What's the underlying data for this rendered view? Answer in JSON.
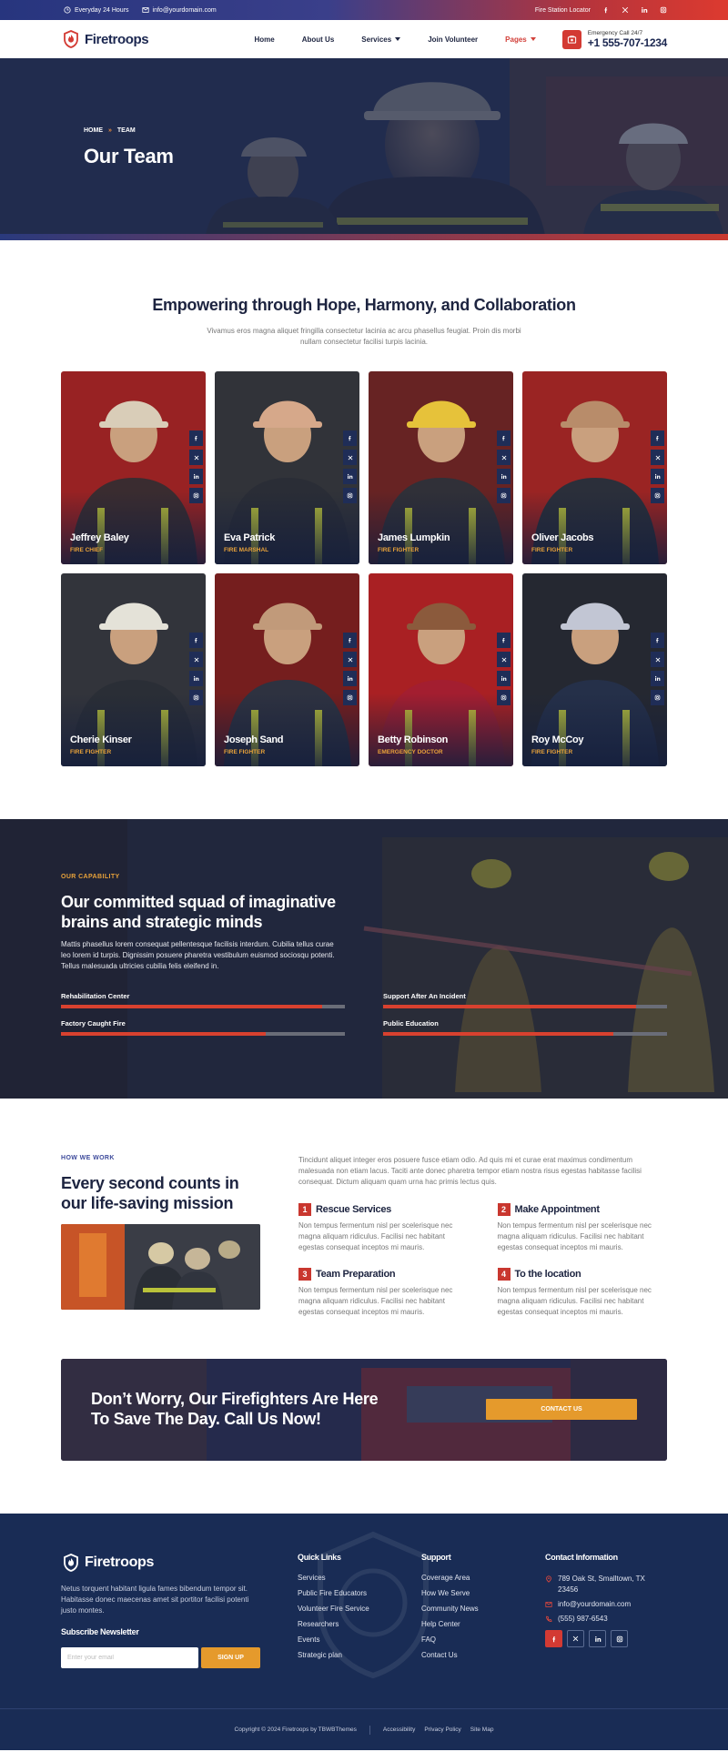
{
  "topbar": {
    "hours": "Everyday 24 Hours",
    "email": "info@yourdomain.com",
    "locator": "Fire Station Locator"
  },
  "header": {
    "logo": "Firetroops",
    "nav": [
      {
        "label": "Home"
      },
      {
        "label": "About Us"
      },
      {
        "label": "Services"
      },
      {
        "label": "Join Volunteer"
      },
      {
        "label": "Pages"
      }
    ],
    "call_label": "Emergency Call 24/7",
    "call_number": "+1 555-707-1234"
  },
  "hero": {
    "crumb_home": "HOME",
    "crumb_sep": "»",
    "crumb_current": "TEAM",
    "title": "Our Team"
  },
  "team": {
    "title": "Empowering through Hope, Harmony, and Collaboration",
    "desc": "Vivamus eros magna aliquet fringilla consectetur lacinia ac arcu phasellus feugiat. Proin dis morbi nullam consectetur facilisi turpis lacinia.",
    "members": [
      {
        "name": "Jeffrey Baley",
        "role": "Fire Chief"
      },
      {
        "name": "Eva Patrick",
        "role": "Fire Marshal"
      },
      {
        "name": "James Lumpkin",
        "role": "Fire Fighter"
      },
      {
        "name": "Oliver Jacobs",
        "role": "Fire Fighter"
      },
      {
        "name": "Cherie Kinser",
        "role": "Fire Fighter"
      },
      {
        "name": "Joseph Sand",
        "role": "Fire Fighter"
      },
      {
        "name": "Betty Robinson",
        "role": "Emergency Doctor"
      },
      {
        "name": "Roy McCoy",
        "role": "Fire Fighter"
      }
    ]
  },
  "capability": {
    "kicker": "OUR CAPABILITY",
    "title": "Our committed squad of imaginative brains and strategic minds",
    "text": "Mattis phasellus lorem consequat pellentesque facilisis interdum. Cubilia tellus curae leo lorem id turpis. Dignissim posuere pharetra vestibulum euismod sociosqu potenti. Tellus malesuada ultricies cubilia felis eleifend in.",
    "bars": [
      {
        "label": "Rehabilitation Center",
        "percent": 92
      },
      {
        "label": "Support After An Incident",
        "percent": 89
      },
      {
        "label": "Factory Caught Fire",
        "percent": 72
      },
      {
        "label": "Public Education",
        "percent": 81
      }
    ]
  },
  "how": {
    "kicker": "HOW WE WORK",
    "title": "Every second counts in our life-saving mission",
    "intro": "Tincidunt aliquet integer eros posuere fusce etiam odio. Ad quis mi et curae erat maximus condimentum malesuada non etiam lacus. Taciti ante donec pharetra tempor etiam nostra risus egestas habitasse facilisi consequat. Dictum aliquam quam urna hac primis lectus quis.",
    "steps": [
      {
        "num": "1",
        "title": "Rescue Services",
        "text": "Non tempus fermentum nisl per scelerisque nec magna aliquam ridiculus. Facilisi nec habitant egestas consequat inceptos mi mauris."
      },
      {
        "num": "2",
        "title": "Make Appointment",
        "text": "Non tempus fermentum nisl per scelerisque nec magna aliquam ridiculus. Facilisi nec habitant egestas consequat inceptos mi mauris."
      },
      {
        "num": "3",
        "title": "Team Preparation",
        "text": "Non tempus fermentum nisl per scelerisque nec magna aliquam ridiculus. Facilisi nec habitant egestas consequat inceptos mi mauris."
      },
      {
        "num": "4",
        "title": "To the location",
        "text": "Non tempus fermentum nisl per scelerisque nec magna aliquam ridiculus. Facilisi nec habitant egestas consequat inceptos mi mauris."
      }
    ]
  },
  "cta": {
    "text": "Don’t Worry, Our Firefighters Are Here To Save The Day. Call Us Now!",
    "button": "CONTACT US"
  },
  "footer": {
    "logo": "Firetroops",
    "desc": "Netus torquent habitant ligula fames bibendum tempor sit. Habitasse donec maecenas amet sit portitor facilisi potenti justo montes.",
    "subscribe_title": "Subscribe Newsletter",
    "email_placeholder": "Enter your email",
    "signup": "SIGN UP",
    "quick_links_title": "Quick Links",
    "quick_links": [
      "Services",
      "Public Fire Educators",
      "Volunteer Fire Service",
      "Researchers",
      "Events",
      "Strategic plan"
    ],
    "support_title": "Support",
    "support_links": [
      "Coverage Area",
      "How We Serve",
      "Community News",
      "Help Center",
      "FAQ",
      "Contact Us"
    ],
    "contact_title": "Contact Information",
    "address": "789 Oak St, Smalltown, TX 23456",
    "email": "info@yourdomain.com",
    "phone": "(555) 987-6543",
    "copyright": "Copyright © 2024 Firetroops by TBWBThemes",
    "legal": [
      "Accessibility",
      "Privacy Policy",
      "Site Map"
    ]
  },
  "colors": {
    "navy": "#1b2750",
    "accent_red": "#d33a33",
    "accent_orange": "#e59a2c",
    "footer_bg": "#192c55"
  }
}
